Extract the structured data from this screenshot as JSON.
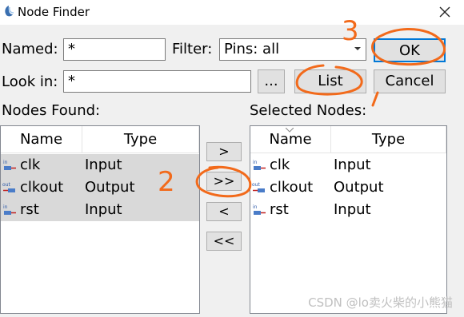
{
  "window": {
    "title": "Node Finder",
    "app_icon": "quartus-icon",
    "close_icon": "close-icon"
  },
  "filters": {
    "named_label": "Named:",
    "named_value": "*",
    "filter_label": "Filter:",
    "filter_value": "Pins: all",
    "look_in_label": "Look in:",
    "look_in_value": "*",
    "browse_label": "..."
  },
  "buttons": {
    "list": "List",
    "ok": "OK",
    "cancel": "Cancel"
  },
  "nodes_found": {
    "title": "Nodes Found:",
    "columns": [
      "Name",
      "Type"
    ],
    "rows": [
      {
        "name": "clk",
        "type": "Input",
        "icon": "input-pin-icon",
        "badge": "in"
      },
      {
        "name": "clkout",
        "type": "Output",
        "icon": "output-pin-icon",
        "badge": "out"
      },
      {
        "name": "rst",
        "type": "Input",
        "icon": "input-pin-icon",
        "badge": "in"
      }
    ]
  },
  "transfer": {
    "add": ">",
    "add_all": ">>",
    "remove": "<",
    "remove_all": "<<"
  },
  "selected_nodes": {
    "title": "Selected Nodes:",
    "columns": [
      "Name",
      "Type"
    ],
    "rows": [
      {
        "name": "clk",
        "type": "Input",
        "icon": "input-pin-icon",
        "badge": "in"
      },
      {
        "name": "clkout",
        "type": "Output",
        "icon": "output-pin-icon",
        "badge": "out"
      },
      {
        "name": "rst",
        "type": "Input",
        "icon": "input-pin-icon",
        "badge": "in"
      }
    ]
  },
  "annotations": {
    "step2": "2",
    "step3": "3",
    "color": "#f26a1b"
  },
  "watermark": "CSDN @lo卖火柴的小熊猫"
}
